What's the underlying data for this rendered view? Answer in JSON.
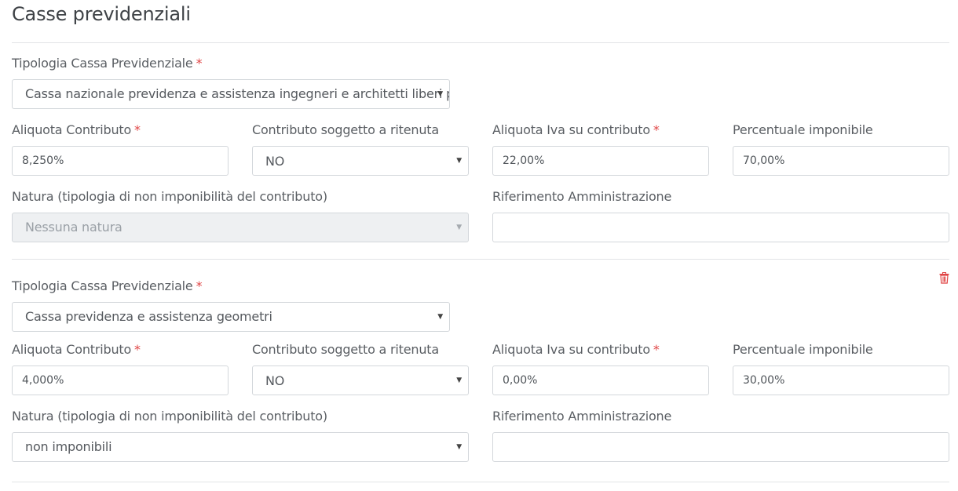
{
  "page_title": "Casse previdenziali",
  "colors": {
    "required": "#e04545",
    "delete_icon": "#e04545",
    "disabled_bg": "#eef0f2"
  },
  "labels": {
    "tipologia": "Tipologia Cassa Previdenziale",
    "aliquota_contributo": "Aliquota Contributo",
    "contributo_ritenuta": "Contributo soggetto a ritenuta",
    "aliquota_iva": "Aliquota Iva su contributo",
    "percentuale_imponibile": "Percentuale imponibile",
    "natura": "Natura (tipologia di non imponibilità del contributo)",
    "riferimento": "Riferimento Amministrazione",
    "required_mark": "*"
  },
  "casse": [
    {
      "tipologia": "Cassa nazionale previdenza e assistenza ingegneri e architetti liberi professionisti",
      "aliquota_contributo": "8,250%",
      "contributo_ritenuta": "NO",
      "aliquota_iva": "22,00%",
      "percentuale_imponibile": "70,00%",
      "natura": "Nessuna natura",
      "natura_disabled": true,
      "riferimento": "",
      "delete_icon": null
    },
    {
      "tipologia": "Cassa previdenza e assistenza geometri",
      "aliquota_contributo": "4,000%",
      "contributo_ritenuta": "NO",
      "aliquota_iva": "0,00%",
      "percentuale_imponibile": "30,00%",
      "natura": "non imponibili",
      "natura_disabled": false,
      "riferimento": "",
      "delete_icon": "trash-icon"
    }
  ],
  "select_arrow": "▼"
}
